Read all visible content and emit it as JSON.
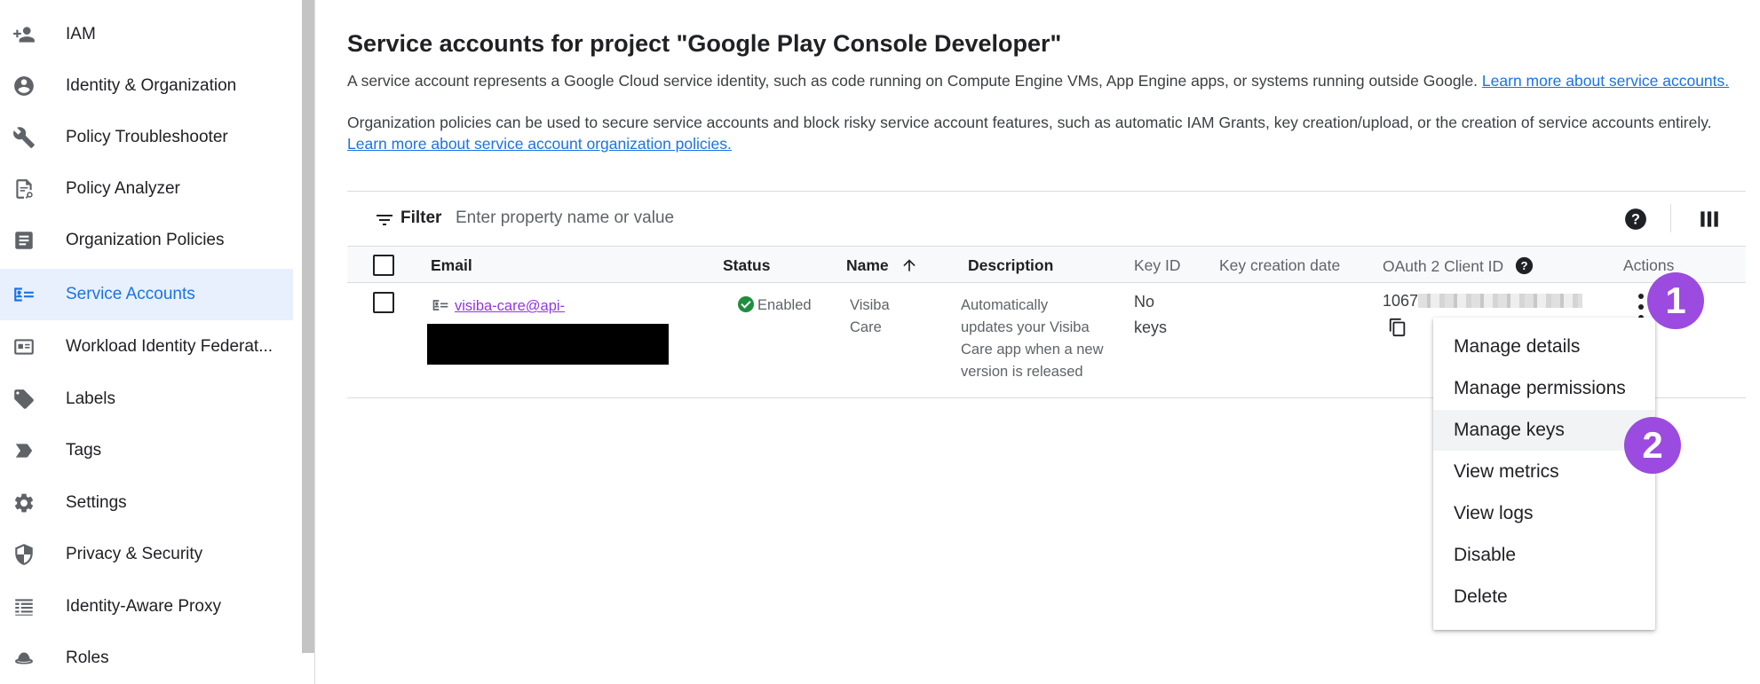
{
  "sidebar": {
    "items": [
      {
        "label": "IAM",
        "icon": "person-add-icon"
      },
      {
        "label": "Identity & Organization",
        "icon": "account-circle-icon"
      },
      {
        "label": "Policy Troubleshooter",
        "icon": "wrench-icon"
      },
      {
        "label": "Policy Analyzer",
        "icon": "policy-doc-icon"
      },
      {
        "label": "Organization Policies",
        "icon": "article-icon"
      },
      {
        "label": "Service Accounts",
        "icon": "service-account-icon",
        "active": true
      },
      {
        "label": "Workload Identity Federat...",
        "icon": "id-card-icon"
      },
      {
        "label": "Labels",
        "icon": "tag-icon"
      },
      {
        "label": "Tags",
        "icon": "label-chevron-icon"
      },
      {
        "label": "Settings",
        "icon": "gear-icon"
      },
      {
        "label": "Privacy & Security",
        "icon": "shield-icon"
      },
      {
        "label": "Identity-Aware Proxy",
        "icon": "proxy-list-icon"
      },
      {
        "label": "Roles",
        "icon": "hat-icon"
      }
    ]
  },
  "main": {
    "title": "Service accounts for project \"Google Play Console Developer\"",
    "desc1": "A service account represents a Google Cloud service identity, such as code running on Compute Engine VMs, App Engine apps, or systems running outside Google.",
    "desc1_link": "Learn more about service accounts.",
    "desc2": "Organization policies can be used to secure service accounts and block risky service account features, such as automatic IAM Grants, key creation/upload, or the creation of service accounts entirely.",
    "desc2_link": "Learn more about service account organization policies."
  },
  "filter": {
    "label": "Filter",
    "placeholder": "Enter property name or value"
  },
  "table": {
    "headers": {
      "email": "Email",
      "status": "Status",
      "name": "Name",
      "description": "Description",
      "key_id": "Key ID",
      "key_creation_date": "Key creation date",
      "oauth_client_id": "OAuth 2 Client ID",
      "actions": "Actions"
    },
    "row": {
      "email": "visiba-care@api-",
      "status": "Enabled",
      "name_line1": "Visiba",
      "name_line2": "Care",
      "desc_lines": [
        "Automatically",
        "updates your Visiba",
        "Care app when a new",
        "version is released"
      ],
      "key_line1": "No",
      "key_line2": "keys",
      "oauth_prefix": "1067"
    }
  },
  "menu": {
    "items": [
      "Manage details",
      "Manage permissions",
      "Manage keys",
      "View metrics",
      "View logs",
      "Disable",
      "Delete"
    ]
  },
  "badges": {
    "step1": "1",
    "step2": "2"
  },
  "colors": {
    "accent": "#1a73e8",
    "active_bg": "#e8f0fe",
    "badge": "#9b4bdf",
    "link_visited": "#9334e6",
    "enabled": "#1e8e3e"
  }
}
